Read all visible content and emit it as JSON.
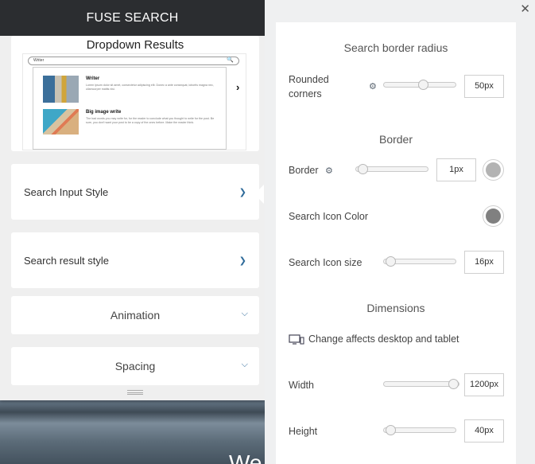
{
  "left": {
    "header_title": "FUSE SEARCH",
    "preview": {
      "title": "Dropdown Results",
      "search_text": "Writer",
      "item1_title": "Writer",
      "item1_text": "Lorem ipsum dolor sit amet, consectetur adipiscing elit. Donec a ante consequat, lobortis magna nec, ullamcorper mattis nisi.",
      "item2_title": "Big image write",
      "item2_text": "The bad words you may write for, for the reader to conclude what you thought to write for the post. Be sure, you don't want your post to be a copy of the ones before. Make the reader think."
    },
    "sections": {
      "input_style": "Search Input Style",
      "result_style": "Search result style",
      "animation": "Animation",
      "spacing": "Spacing"
    }
  },
  "right": {
    "close_icon": "close-icon",
    "border_radius_section": "Search border radius",
    "rounded_corners_label": "Rounded corners",
    "rounded_corners_value": "50px",
    "rounded_corners_level": 0.56,
    "border_section": "Border",
    "border_label": "Border",
    "border_value": "1px",
    "border_level": 0.02,
    "border_color": "#b3b3b3",
    "icon_color_label": "Search Icon Color",
    "icon_color": "#808080",
    "icon_size_label": "Search Icon size",
    "icon_size_value": "16px",
    "icon_size_level": 0.02,
    "dimensions_section": "Dimensions",
    "dimensions_note": "Change affects desktop and tablet",
    "width_label": "Width",
    "width_value": "1200px",
    "width_level": 1.0,
    "height_label": "Height",
    "height_value": "40px",
    "height_level": 0.03
  },
  "background": {
    "heading_fragment": "We"
  },
  "colors": {
    "header_bg": "#2b2d30",
    "accent_chevron": "#2f6b9a"
  }
}
